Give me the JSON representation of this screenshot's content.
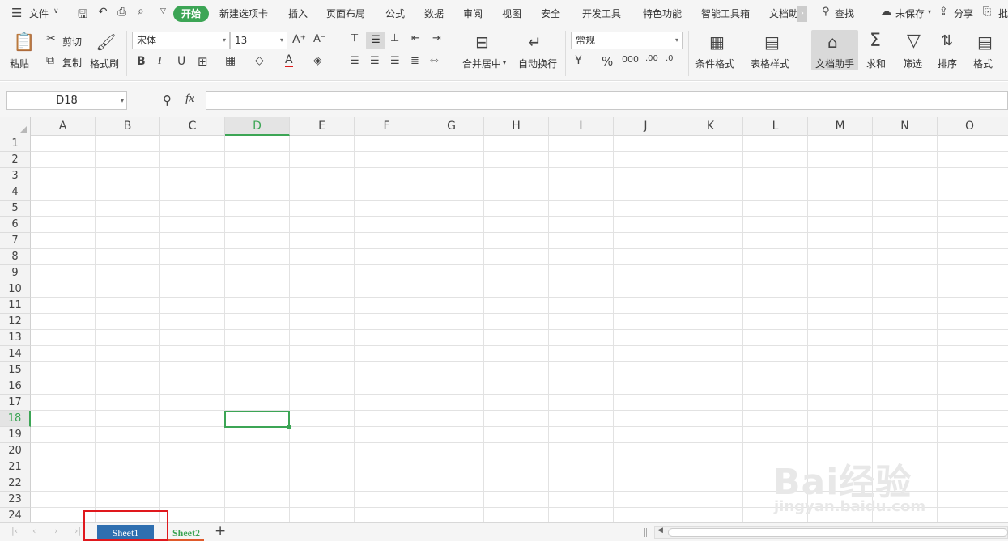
{
  "menu": {
    "file": "文件",
    "start": "开始",
    "tabs": [
      "新建选项卡",
      "插入",
      "页面布局",
      "公式",
      "数据",
      "审阅",
      "视图",
      "安全",
      "开发工具",
      "特色功能",
      "智能工具箱",
      "文档助"
    ],
    "find": "查找",
    "unsaved": "未保存",
    "share": "分享",
    "batch": "批"
  },
  "ribbon": {
    "paste": "粘贴",
    "cut": "剪切",
    "copy": "复制",
    "format_painter": "格式刷",
    "font_name": "宋体",
    "font_size": "13",
    "merge_center": "合并居中",
    "auto_wrap": "自动换行",
    "number_format": "常规",
    "cond_format": "条件格式",
    "table_style": "表格样式",
    "doc_assistant": "文档助手",
    "sum": "求和",
    "filter": "筛选",
    "sort": "排序",
    "format": "格式"
  },
  "formula_bar": {
    "name_box": "D18",
    "fx": "fx",
    "value": ""
  },
  "grid": {
    "columns": [
      "A",
      "B",
      "C",
      "D",
      "E",
      "F",
      "G",
      "H",
      "I",
      "J",
      "K",
      "L",
      "M",
      "N",
      "O"
    ],
    "rows": [
      "1",
      "2",
      "3",
      "4",
      "5",
      "6",
      "7",
      "8",
      "9",
      "10",
      "11",
      "12",
      "13",
      "14",
      "15",
      "16",
      "17",
      "18",
      "19",
      "20",
      "21",
      "22",
      "23",
      "24"
    ],
    "active_cell": "D18"
  },
  "sheets": {
    "tab1": "Sheet1",
    "tab2": "Sheet2",
    "add": "+"
  },
  "watermark": {
    "brand": "Bai经验",
    "url": "jingyan.baidu.com"
  },
  "colors": {
    "accent": "#3ca555",
    "selected_tab": "#2f6fb0",
    "highlight_box": "#e0181d"
  }
}
